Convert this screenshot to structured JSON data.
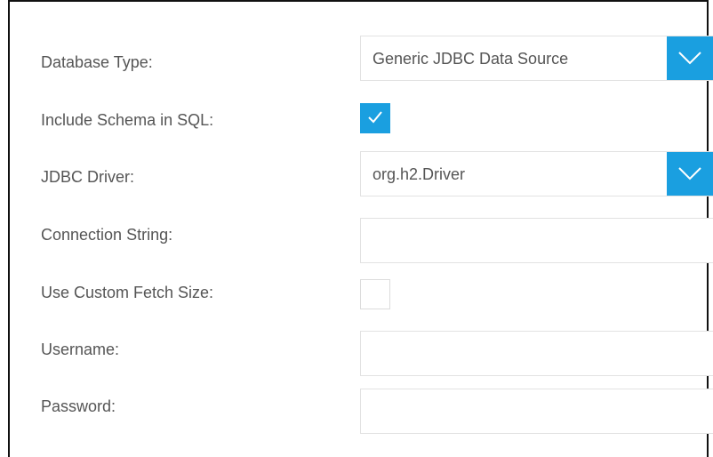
{
  "form": {
    "database_type": {
      "label": "Database Type:",
      "value": "Generic JDBC Data Source"
    },
    "include_schema": {
      "label": "Include Schema in SQL:",
      "checked": true
    },
    "jdbc_driver": {
      "label": "JDBC Driver:",
      "value": "org.h2.Driver"
    },
    "connection_string": {
      "label": "Connection String:",
      "value": ""
    },
    "custom_fetch_size": {
      "label": "Use Custom Fetch Size:",
      "checked": false
    },
    "username": {
      "label": "Username:",
      "value": ""
    },
    "password": {
      "label": "Password:",
      "value": ""
    }
  },
  "icons": {
    "dropdown": "chevron-down-icon",
    "check": "checkmark-icon"
  },
  "colors": {
    "accent": "#1a9fe0",
    "label_text": "#555555",
    "field_border": "#e2e2e2"
  }
}
